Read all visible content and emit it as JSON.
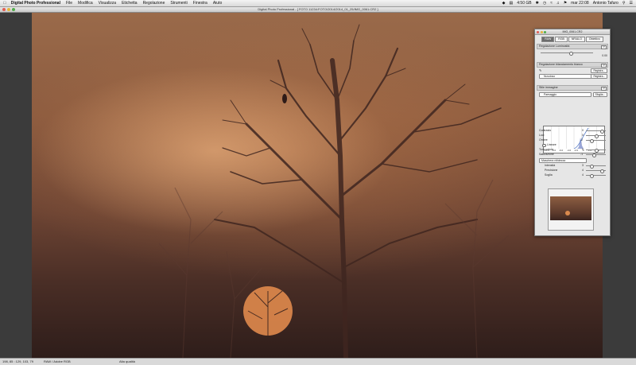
{
  "menubar": {
    "app_name": "Digital Photo Professional",
    "items": [
      "File",
      "Modifica",
      "Visualizza",
      "Etichetta",
      "Regolazione",
      "Strumenti",
      "Finestra",
      "Aiuto"
    ],
    "status": {
      "battery": "4:50 GB",
      "datetime": "mar 22:08",
      "user": "Antonio Tafuro"
    }
  },
  "window": {
    "title": "Digital Photo Professional - [ FOTO 11234:FOTO/2014/2014_01_25/IMG_0061.CR2 ]"
  },
  "statusbar": {
    "coords": "198,  85 : 129, 103,  79",
    "colorspace": "RAW / Adobe RGB",
    "quality": "Alta qualità"
  },
  "palette": {
    "title": "IMG_0061.CR2",
    "tabs": [
      {
        "label": "RAW",
        "active": true
      },
      {
        "label": "RGB",
        "active": false
      },
      {
        "label": "NR/ALO",
        "active": false
      },
      {
        "label": "Obiettivo",
        "active": false
      }
    ],
    "brightness": {
      "header": "Regolazione Luminosità",
      "value": "0.00"
    },
    "wb": {
      "header": "Regolazione bilanciamento bianco",
      "preset": "Nuvoloso",
      "button": "Registra...",
      "button_top": "Registra..."
    },
    "style": {
      "header": "Stile immagine",
      "preset": "Paesaggio",
      "button": "Sfoglia...",
      "hist_ticks": [
        "-10.0",
        "-8.0",
        "-6.0",
        "-4.0",
        "-2.0",
        "0",
        "2.0",
        "4.0"
      ]
    },
    "controls": [
      {
        "label": "Contrasto",
        "value": "0"
      },
      {
        "label": "Luci",
        "value": "0"
      },
      {
        "label": "Ombre",
        "value": "-2"
      },
      {
        "label": "Tono colore",
        "value": "0"
      },
      {
        "label": "Saturazione",
        "value": "-1"
      }
    ],
    "linear": {
      "label": "Lineare"
    },
    "sharp": {
      "mode": "Maschera nitidezza",
      "items": [
        {
          "label": "Intensità",
          "value": "3"
        },
        {
          "label": "Precisione",
          "value": "4"
        },
        {
          "label": "Soglia",
          "value": "4"
        }
      ]
    }
  },
  "colors": {
    "accent": "#5a7fc9",
    "traffic_red": "#e25b52",
    "traffic_yellow": "#e6b53a",
    "traffic_green": "#4fae4a"
  }
}
